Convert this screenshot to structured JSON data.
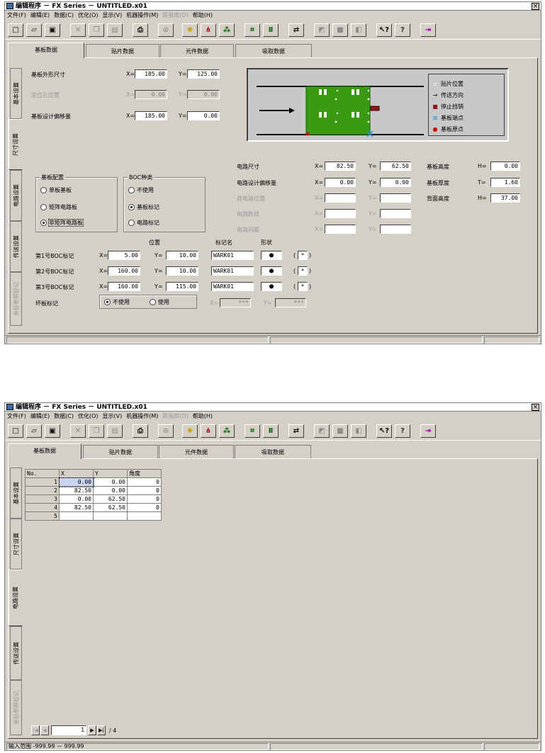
{
  "window": {
    "title": "编辑程序 － FX Series － UNTITLED.x01",
    "close_glyph": "×"
  },
  "menu": [
    "文件(F)",
    "编辑(E)",
    "数据(C)",
    "优化(O)",
    "显示(V)",
    "机器操作(M)",
    "跌报库(D)",
    "帮助(H)"
  ],
  "toolbar_icons": [
    "new-icon",
    "open-icon",
    "save-icon",
    "cut-icon",
    "copy-icon",
    "paste-icon",
    "print-icon",
    "binoculars-icon",
    "lightbulb-icon",
    "pick-icon",
    "optimize-icon",
    "board-icon",
    "mark-icon",
    "transfer-icon",
    "disabled-icon-1",
    "disabled-icon-2",
    "disabled-icon-3",
    "context-help-icon",
    "help-icon",
    "exit-icon"
  ],
  "tabs": [
    "基板数据",
    "贴片数据",
    "元件数据",
    "吸取数据"
  ],
  "side_tabs_top": [
    "基本设置",
    "尺寸设置",
    "电路设置",
    "传送设置",
    "坐标参照标记"
  ],
  "side_tabs_bottom": [
    "基本设置",
    "尺寸设置",
    "电路设置",
    "传送设置",
    "坐标参照标记"
  ],
  "size_form": {
    "outline_label": "基板外形尺寸",
    "outline_x": "185.00",
    "outline_y": "125.00",
    "hole_label": "定位孔位置",
    "hole_x": "0.00",
    "hole_y": "0.00",
    "offset_label": "基板设计偏移量",
    "offset_x": "185.00",
    "offset_y": "0.00",
    "x_prefix": "X=",
    "y_prefix": "Y=",
    "h_prefix": "H=",
    "t_prefix": "T=",
    "circuit_size_label": "电路尺寸",
    "circuit_size_x": "82.50",
    "circuit_size_y": "62.50",
    "circuit_offset_label": "电路设计偏移量",
    "circuit_offset_x": "0.00",
    "circuit_offset_y": "0.00",
    "first_circuit_label": "首电路位置",
    "circuit_count_label": "电路数目",
    "circuit_pitch_label": "电路间距",
    "board_height_label": "基板高度",
    "board_height": "0.00",
    "board_thickness_label": "基板厚度",
    "board_thickness": "1.60",
    "back_height_label": "背面高度",
    "back_height": "37.00"
  },
  "board_config": {
    "title": "基板配置",
    "options": [
      "单板基板",
      "矩阵电路板",
      "非矩阵电路板"
    ],
    "selected": 2
  },
  "boc_type": {
    "title": "BOC种类",
    "options": [
      "不使用",
      "基板标记",
      "电路标记"
    ],
    "selected": 1
  },
  "marks": {
    "position_header": "位置",
    "name_header": "标记名",
    "shape_header": "形状",
    "rows": [
      {
        "label": "第1号BOC标记",
        "x": "5.00",
        "y": "10.00",
        "name": "WARK01",
        "asterisk": "*"
      },
      {
        "label": "第2号BOC标记",
        "x": "160.00",
        "y": "10.00",
        "name": "WARK01",
        "asterisk": "*"
      },
      {
        "label": "第3号BOC标记",
        "x": "160.00",
        "y": "115.00",
        "name": "WARK01",
        "asterisk": "*"
      }
    ],
    "shape_glyph": "●",
    "paren_open": "(",
    "paren_close": ")"
  },
  "ring_mark": {
    "label": "坏板标记",
    "options": [
      "不使用",
      "使用"
    ],
    "selected": 0,
    "x": "***",
    "y": "***"
  },
  "legend": [
    {
      "symbol": "▫",
      "text": "贴片位置",
      "color": "#ffffff"
    },
    {
      "symbol": "→",
      "text": "传送方向",
      "color": "#000000"
    },
    {
      "symbol": "■",
      "text": "停止挡销",
      "color": "#8b1a1a"
    },
    {
      "symbol": "⊠",
      "text": "基板端点",
      "color": "#1f9bd1"
    },
    {
      "symbol": "●",
      "text": "基板原点",
      "color": "#d00000"
    }
  ],
  "colors": {
    "board_green": "#3a9a12",
    "window_face": "#d4d0c8"
  },
  "circuit_table": {
    "headers": [
      "No.",
      "X",
      "Y",
      "角度"
    ],
    "rows": [
      {
        "no": "1",
        "x": "0.00",
        "y": "0.00",
        "angle": "0"
      },
      {
        "no": "2",
        "x": "82.50",
        "y": "0.00",
        "angle": "0"
      },
      {
        "no": "3",
        "x": "0.00",
        "y": "62.50",
        "angle": "0"
      },
      {
        "no": "4",
        "x": "82.50",
        "y": "62.50",
        "angle": "0"
      },
      {
        "no": "5",
        "x": "",
        "y": "",
        "angle": ""
      }
    ]
  },
  "pager": {
    "value": "1",
    "total": "/ 4"
  },
  "status": {
    "text": "输入范围 -999.99 － 999.99"
  }
}
